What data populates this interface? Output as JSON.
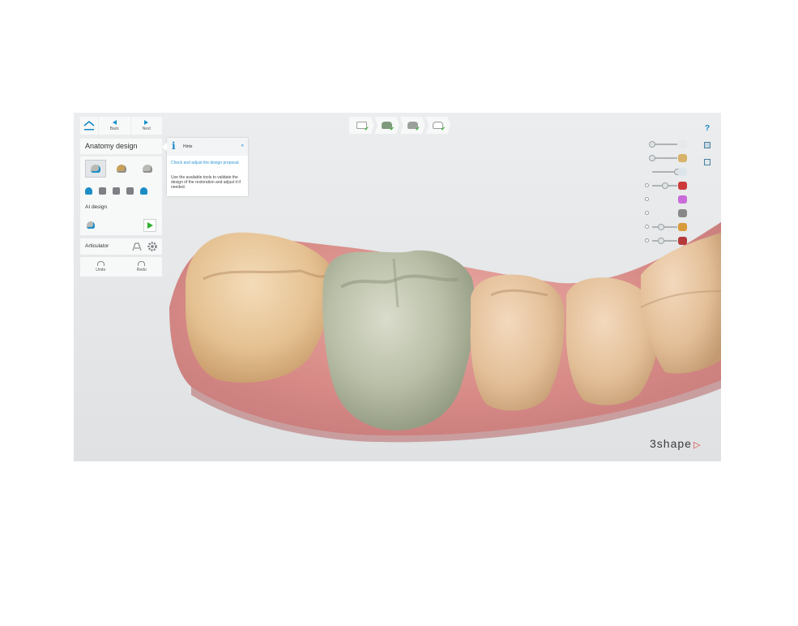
{
  "nav": {
    "back_label": "Back",
    "next_label": "Next"
  },
  "panel": {
    "title": "Anatomy design",
    "ai_design_label": "AI design",
    "articulator_label": "Articulator",
    "undo_label": "Undo",
    "redo_label": "Redo"
  },
  "hints": {
    "title": "Hints",
    "collapse_glyph": "«",
    "heading": "Check and adjust the design proposal",
    "body": "Use the available tools to validate the design of the restoration and adjust it if needed."
  },
  "workflow": {
    "steps": [
      {
        "icon": "order-form-icon",
        "completed": true
      },
      {
        "icon": "preparation-scan-icon",
        "completed": true
      },
      {
        "icon": "margin-line-icon",
        "completed": true
      },
      {
        "icon": "crown-design-icon",
        "completed": true
      }
    ],
    "check_glyph": "✔"
  },
  "right_toolbar": {
    "help_glyph": "?"
  },
  "sliders": [
    {
      "glyph": "tooth-white-icon",
      "value": 0.0,
      "color": "#e8e8e8",
      "has_dot": false
    },
    {
      "glyph": "antagonist-icon",
      "value": 0.0,
      "color": "#d9b36b",
      "has_dot": false
    },
    {
      "glyph": "crown-icon",
      "value": 1.0,
      "color": "#dce6ea",
      "has_dot": false
    },
    {
      "glyph": "cut-icon",
      "value": 0.5,
      "color": "#cc3a3a",
      "has_dot": true
    },
    {
      "glyph": "color-wheel-icon",
      "value": null,
      "color": "#c96bd9",
      "has_dot": true
    },
    {
      "glyph": "gingiva-icon",
      "value": null,
      "color": "#888888",
      "has_dot": true
    },
    {
      "glyph": "preparation-icon",
      "value": 0.35,
      "color": "#d99a3a",
      "has_dot": true
    },
    {
      "glyph": "die-icon",
      "value": 0.35,
      "color": "#b53a3a",
      "has_dot": true
    }
  ],
  "brand": {
    "name": "3shape",
    "mark": "▷"
  }
}
